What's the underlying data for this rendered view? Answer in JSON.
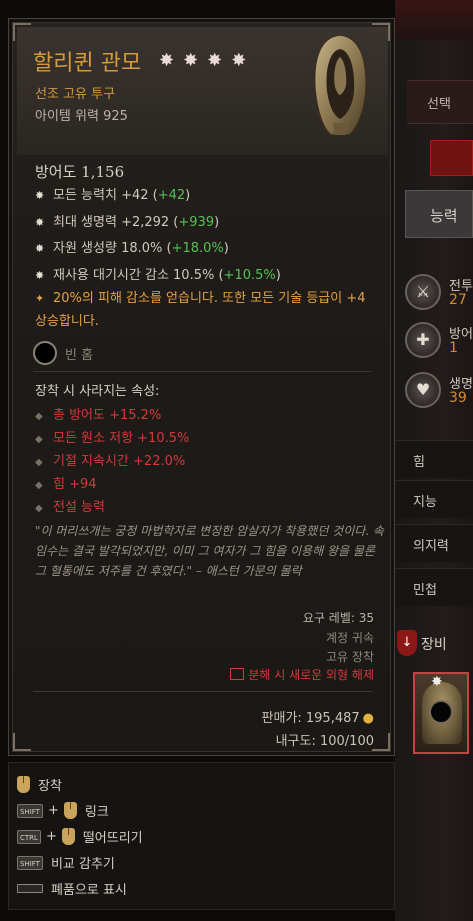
{
  "side_panel": {
    "select_label": "선택",
    "tab_label": "능력",
    "stats": [
      {
        "label": "전투",
        "value": "27"
      },
      {
        "label": "방어",
        "value": "1"
      },
      {
        "label": "생명",
        "value": "39"
      }
    ],
    "attributes": [
      "힘",
      "지능",
      "의지력",
      "민첩"
    ],
    "equip_label": "장비"
  },
  "item": {
    "name": "할리퀸 관모",
    "gems": "✸✸✸✸",
    "type_line": "선조 고유 투구",
    "item_power": "아이템 위력 925",
    "armor": "방어도 1,156",
    "affixes": [
      {
        "text": "모든 능력치 +42 (",
        "bonus": "+42",
        "close": ")"
      },
      {
        "text": "최대 생명력 +2,292 (",
        "bonus": "+939",
        "close": ")"
      },
      {
        "text": "자원 생성량 18.0% (",
        "bonus": "+18.0%",
        "close": ")"
      },
      {
        "text": "재사용 대기시간 감소 10.5% (",
        "bonus": "+10.5%",
        "close": ")"
      }
    ],
    "unique_effect": "20%의 피해 감소를 얻습니다. 또한 모든 기술 등급이 +4 상승합니다.",
    "socket_label": "빈 홈",
    "lost_header": "장착 시 사라지는 속성:",
    "lost_stats": [
      "총 방어도 +15.2%",
      "모든 원소 저항 +10.5%",
      "기절 지속시간 +22.0%",
      "힘 +94",
      "전설 능력"
    ],
    "flavor": "\"이 머리쓰개는 궁정 마법학자로 변장한 암살자가 착용했던 것이다. 속임수는 결국 발각되었지만, 이미 그 여자가 그 힘을 이용해 왕을 물론 그 혈통에도 저주를 건 후였다.\" – 애스턴 가문의 몰락",
    "required_level": "요구 레벨: 35",
    "account_bound": "계정 귀속",
    "unique_equip": "고유 장착",
    "salvage_note": "분해 시 새로운 외형 해제",
    "sell_value": "판매가: 195,487",
    "durability": "내구도: 100/100"
  },
  "hints": [
    {
      "keys": [],
      "label": "장착"
    },
    {
      "keys": [
        "SHIFT"
      ],
      "label": "링크"
    },
    {
      "keys": [
        "CTRL"
      ],
      "label": "떨어뜨리기"
    },
    {
      "keys": [
        "SHIFT"
      ],
      "label": "비교 감추기"
    },
    {
      "keys": [
        "bar"
      ],
      "label": "폐품으로 표시"
    }
  ],
  "colors": {
    "title": "#d39a3f",
    "bonus": "#56c056",
    "unique": "#e5a245",
    "lost": "#d23a3a"
  }
}
